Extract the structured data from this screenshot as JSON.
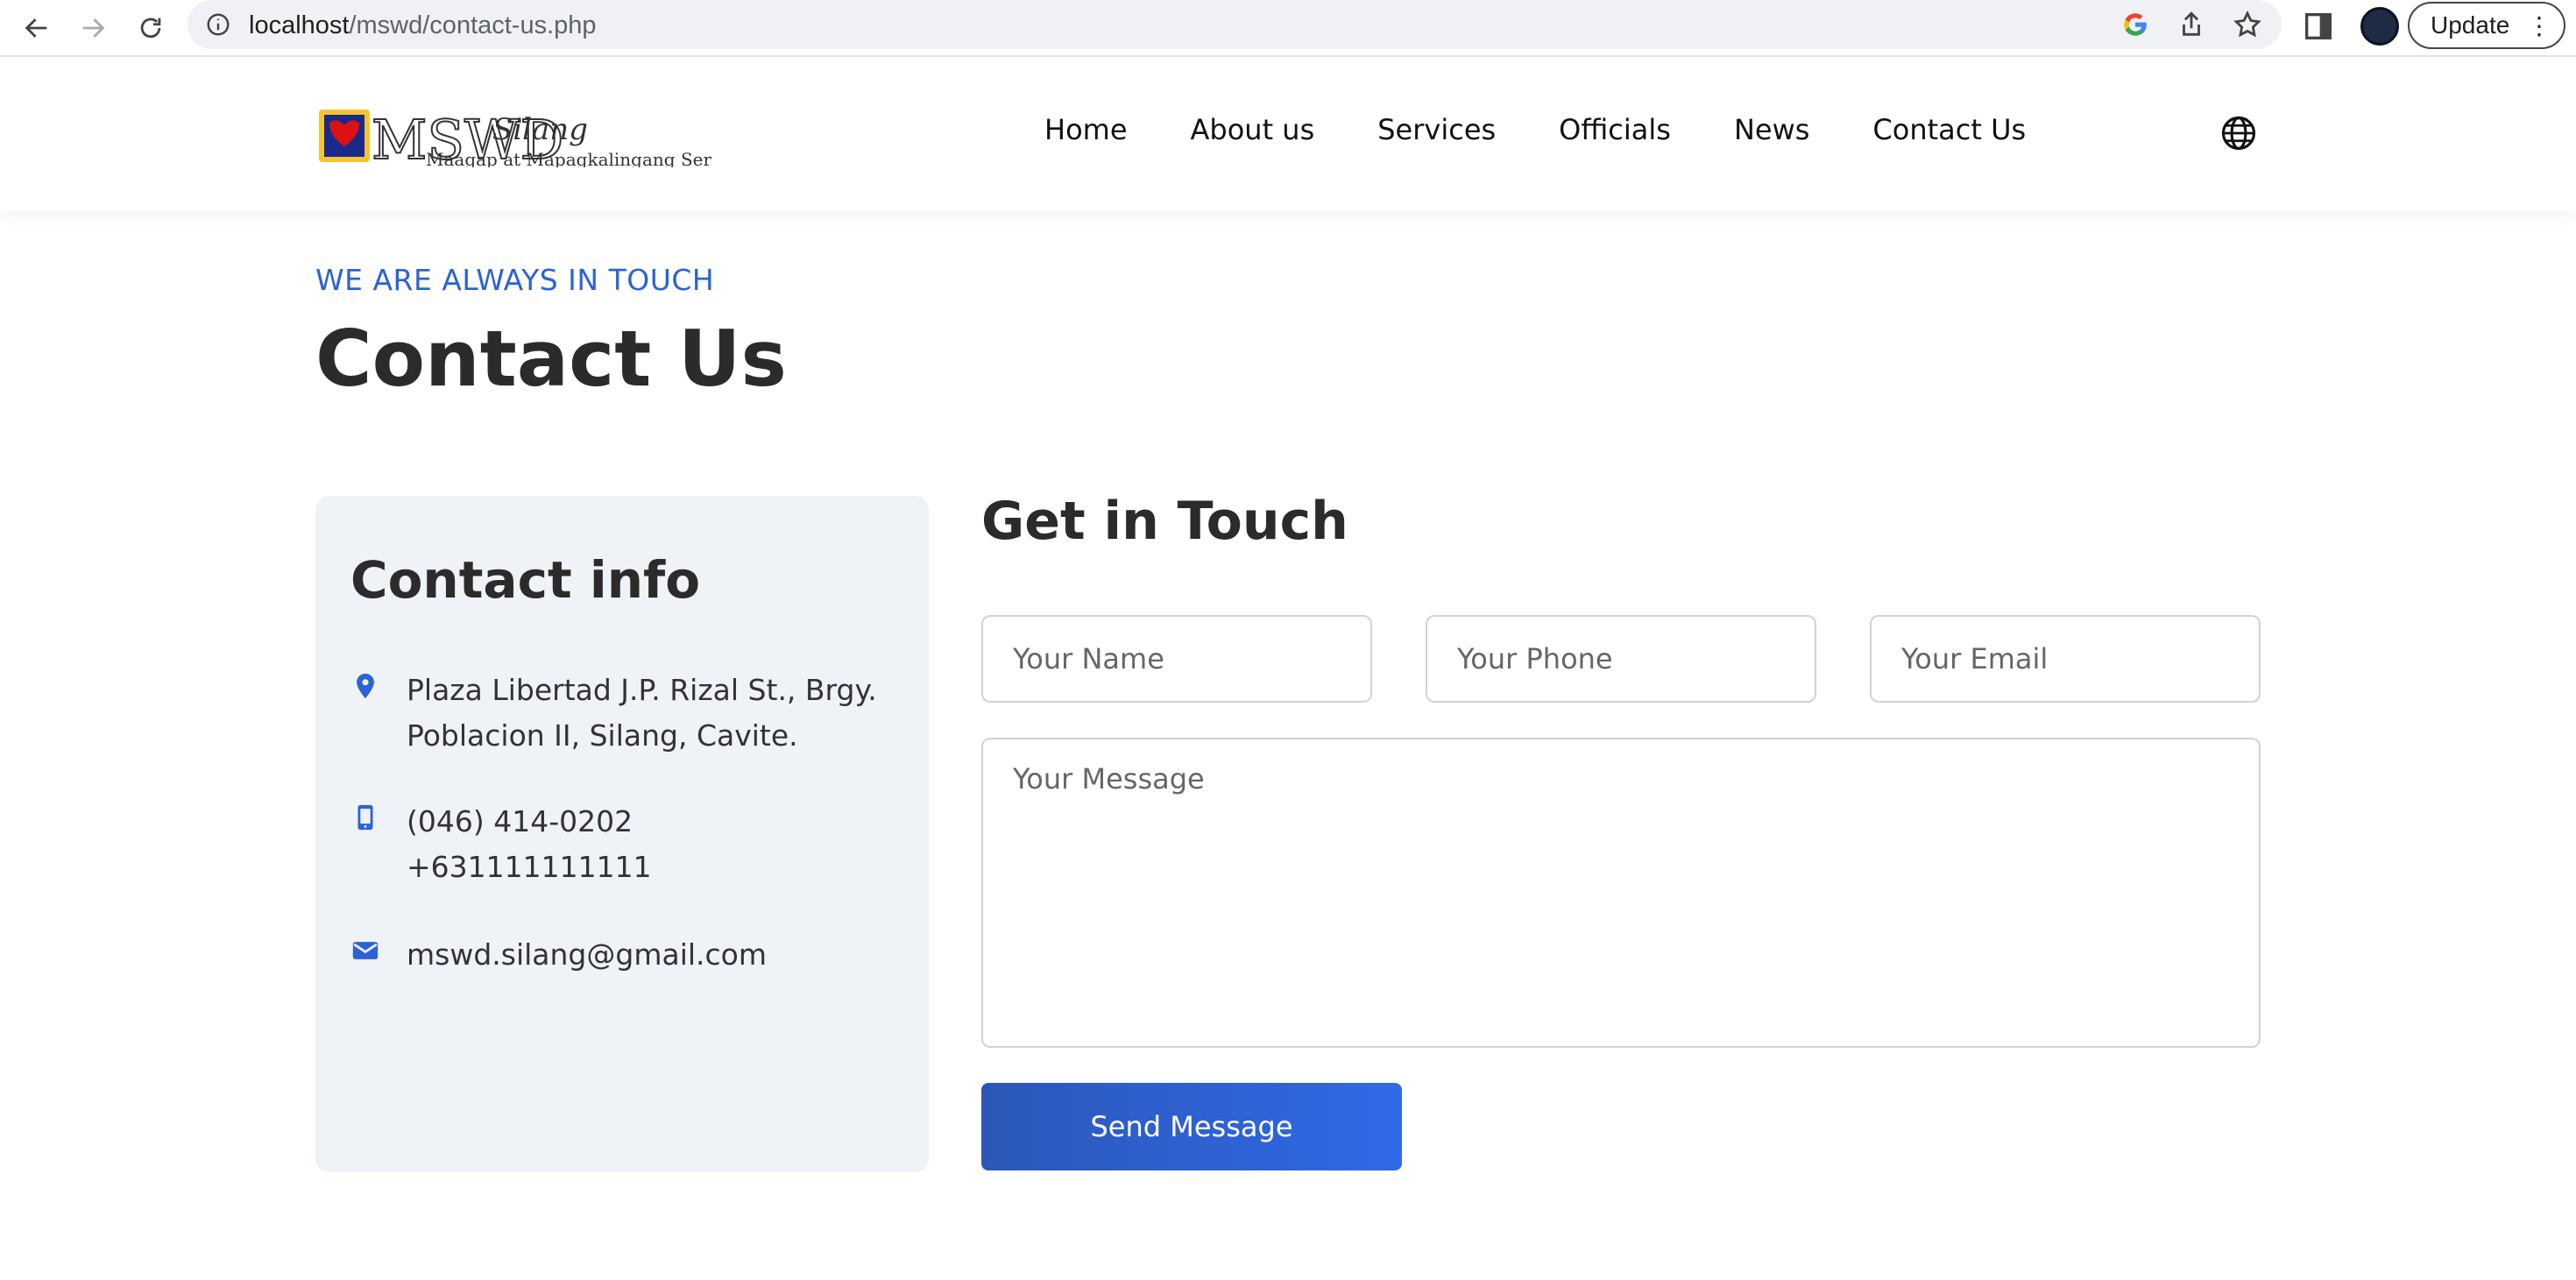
{
  "browser": {
    "url_host": "localhost",
    "url_path": "/mswd/contact-us.php",
    "update_label": "Update"
  },
  "site": {
    "logo": {
      "mark": "MSWD",
      "script": "Silang",
      "tagline": "Maagap at Mapagkalingang Serbisyo"
    },
    "nav": [
      {
        "label": "Home"
      },
      {
        "label": "About us"
      },
      {
        "label": "Services"
      },
      {
        "label": "Officials"
      },
      {
        "label": "News"
      },
      {
        "label": "Contact Us"
      }
    ]
  },
  "hero": {
    "eyebrow": "WE ARE ALWAYS IN TOUCH",
    "title": "Contact Us"
  },
  "contact_info": {
    "title": "Contact info",
    "address_line1": "Plaza Libertad J.P. Rizal St., Brgy.",
    "address_line2": "Poblacion II, Silang, Cavite.",
    "phone1": "(046) 414-0202",
    "phone2": "+631111111111",
    "email": "mswd.silang@gmail.com"
  },
  "form": {
    "title": "Get in Touch",
    "name_placeholder": "Your Name",
    "phone_placeholder": "Your Phone",
    "email_placeholder": "Your Email",
    "message_placeholder": "Your Message",
    "submit_label": "Send Message"
  },
  "colors": {
    "accent": "#2b63d6",
    "card_bg": "#eff2f6",
    "button_start": "#2c57b8",
    "button_end": "#2f6ae8"
  }
}
